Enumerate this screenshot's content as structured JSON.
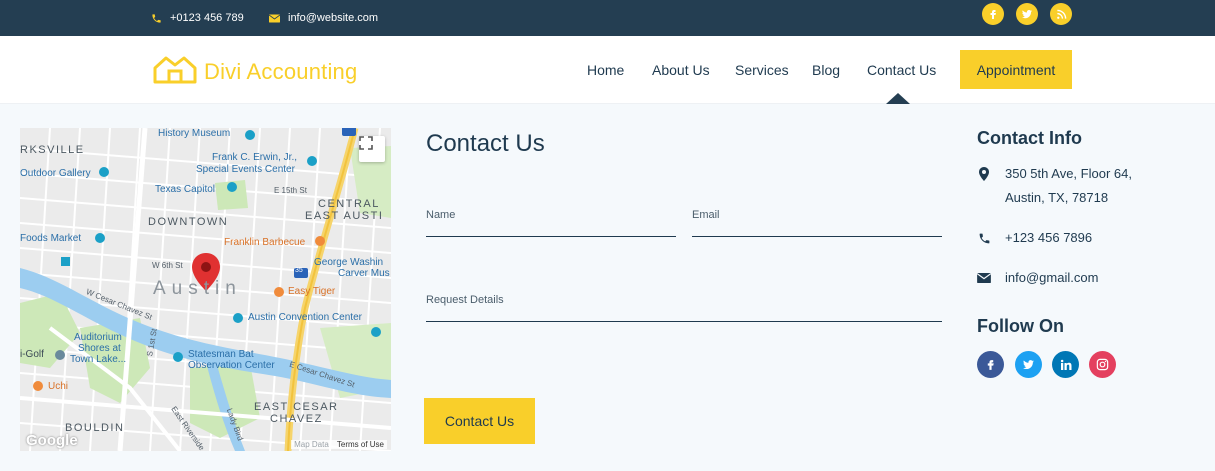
{
  "topbar": {
    "phone": "+0123 456 789",
    "email": "info@website.com",
    "social": [
      {
        "icon": "facebook-icon",
        "glyph": "f"
      },
      {
        "icon": "twitter-icon",
        "glyph": "t"
      },
      {
        "icon": "rss-icon",
        "glyph": "rss"
      }
    ]
  },
  "header": {
    "logo_text": "Divi Accounting",
    "nav": [
      {
        "label": "Home"
      },
      {
        "label": "About Us"
      },
      {
        "label": "Services"
      },
      {
        "label": "Blog"
      },
      {
        "label": "Contact Us",
        "active": true
      }
    ],
    "appointment_label": "Appointment"
  },
  "map": {
    "labels": {
      "history_museum": "History Museum",
      "rksville": "RKSVILLE",
      "erwin": "Frank C. Erwin, Jr.,",
      "erwin2": "Special Events Center",
      "outdoor": "Outdoor Gallery",
      "capitol": "Texas Capitol",
      "e15": "E 15th St",
      "central": "CENTRAL",
      "east_austin": "EAST AUSTI",
      "downtown": "DOWNTOWN",
      "foods_market": "Foods Market",
      "franklin": "Franklin Barbecue",
      "george": "George Washin",
      "george2": "Carver Mus",
      "w6": "W 6th St",
      "austin": "Austin",
      "easy_tiger": "Easy Tiger",
      "w_cesar": "W Cesar Chavez St",
      "convention": "Austin Convention Center",
      "auditorium": "Auditorium",
      "auditorium2": "Shores at",
      "auditorium3": "Town Lake...",
      "golf": "i-Golf",
      "statesman": "Statesman Bat",
      "statesman2": "Observation Center",
      "e_cesar": "E Cesar Chavez St",
      "uchi": "Uchi",
      "east_cesar": "EAST CESAR",
      "chavez": "CHAVEZ",
      "bouldin": "BOULDIN",
      "s1st": "S 1st St",
      "lady_bird": "Lady Bird",
      "riverside": "East Riverside",
      "i35": "35",
      "google": "Google",
      "map_data": "Map Data",
      "terms": "Terms of Use"
    }
  },
  "form": {
    "title": "Contact Us",
    "name_placeholder": "Name",
    "email_placeholder": "Email",
    "details_placeholder": "Request Details",
    "submit_label": "Contact Us"
  },
  "info": {
    "title": "Contact Info",
    "address_line1": "350 5th Ave, Floor 64,",
    "address_line2": "Austin, TX, 78718",
    "phone": "+123 456 7896",
    "email": "info@gmail.com",
    "follow_title": "Follow On",
    "follow": [
      {
        "icon": "facebook-icon",
        "color": "#3b5998"
      },
      {
        "icon": "twitter-icon",
        "color": "#1da1f2"
      },
      {
        "icon": "linkedin-icon",
        "color": "#0077b5"
      },
      {
        "icon": "instagram-icon",
        "color": "#e4405f"
      }
    ]
  },
  "colors": {
    "accent": "#f9cf2a",
    "dark": "#243e52",
    "text": "#1f3a4f"
  }
}
